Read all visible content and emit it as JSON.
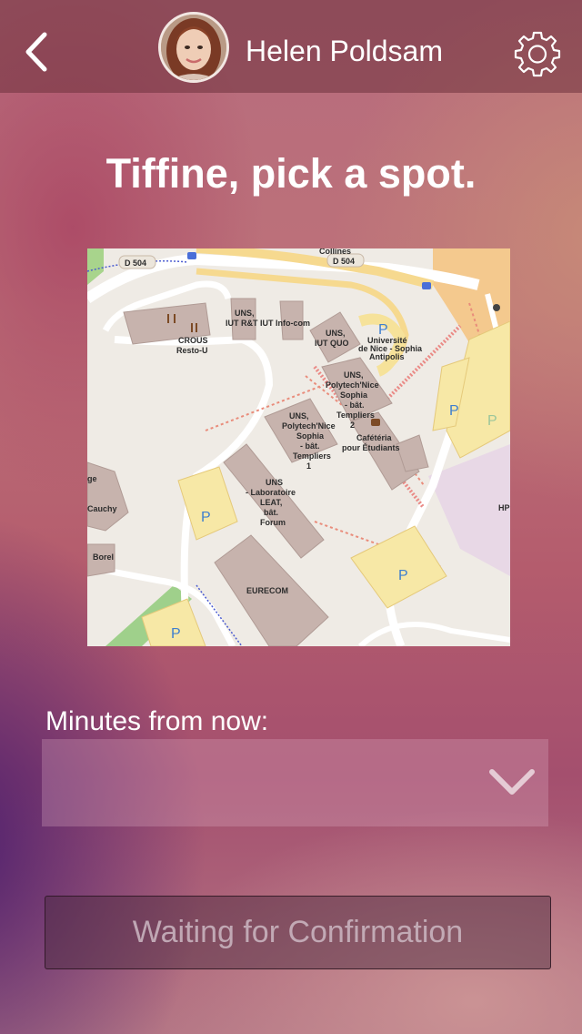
{
  "header": {
    "back_icon": "chevron-left-icon",
    "user_name": "Helen Poldsam",
    "settings_icon": "gear-icon"
  },
  "main": {
    "title": "Tiffine, pick a spot.",
    "map": {
      "road_labels": [
        "D 504",
        "D 504",
        "Collines"
      ],
      "places": [
        {
          "lines": [
            "CROUS",
            "Resto-U"
          ]
        },
        {
          "lines": [
            "UNS,",
            "IUT R&T IUT Info-com"
          ]
        },
        {
          "lines": [
            "UNS,",
            "IUT QUO"
          ]
        },
        {
          "lines": [
            "Université",
            "de Nice - Sophia",
            "Antipolis"
          ]
        },
        {
          "lines": [
            "UNS,",
            "Polytech'Nice",
            "Sophia",
            "- bât.",
            "Templiers",
            "2"
          ]
        },
        {
          "lines": [
            "UNS,",
            "Polytech'Nice",
            "Sophia",
            "- bât.",
            "Templiers",
            "1"
          ]
        },
        {
          "lines": [
            "Cafétéria",
            "pour Étudiants"
          ]
        },
        {
          "lines": [
            "UNS",
            "- Laboratoire",
            "LEAT,",
            "bât.",
            "Forum"
          ]
        },
        {
          "lines": [
            "EURECOM"
          ]
        },
        {
          "lines": [
            "Cauchy"
          ]
        },
        {
          "lines": [
            "Borel"
          ]
        },
        {
          "lines": [
            "HP"
          ]
        },
        {
          "lines": [
            "ge"
          ]
        }
      ],
      "parking_symbol": "P"
    },
    "minutes_label": "Minutes from now:",
    "minutes_value": "",
    "dropdown_icon": "chevron-down-icon",
    "confirm_button": "Waiting for Confirmation"
  },
  "colors": {
    "header_bg": "#7a3c48",
    "text": "#ffffff",
    "button_text": "#cdb9c3"
  }
}
